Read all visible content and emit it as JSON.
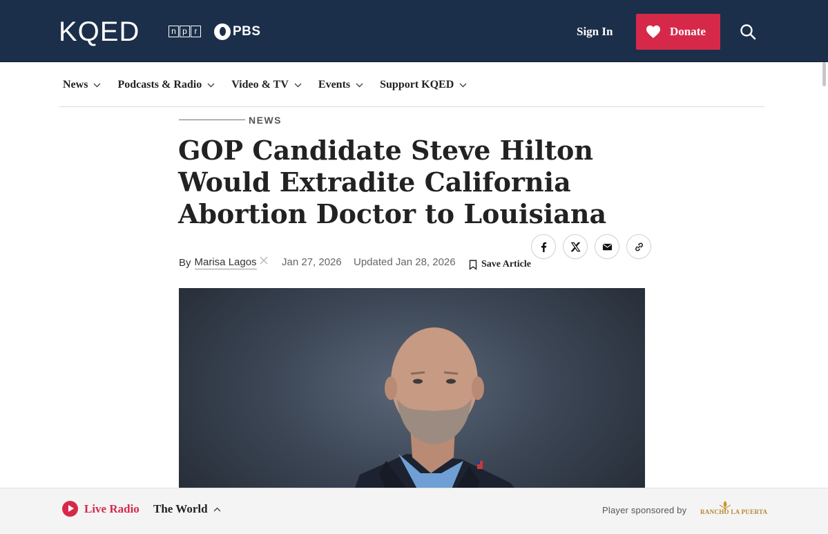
{
  "header": {
    "logo": "KQED",
    "partners": {
      "npr_letters": [
        "n",
        "p",
        "r"
      ],
      "pbs": "PBS"
    },
    "sign_in": "Sign In",
    "donate": "Donate",
    "colors": {
      "header_bg": "#1b2f4a",
      "donate_bg": "#d6294a"
    }
  },
  "nav": {
    "items": [
      {
        "label": "News"
      },
      {
        "label": "Podcasts & Radio"
      },
      {
        "label": "Video & TV"
      },
      {
        "label": "Events"
      },
      {
        "label": "Support KQED"
      }
    ]
  },
  "article": {
    "kicker": "NEWS",
    "headline": "GOP Candidate Steve Hilton Would Extradite California Abortion Doctor to Louisiana",
    "byline_prefix": "By",
    "author": "Marisa Lagos",
    "published": "Jan 27, 2026",
    "updated": "Updated Jan 28, 2026",
    "save_label": "Save Article",
    "share_icons": [
      "facebook-icon",
      "x-icon",
      "email-icon",
      "link-icon"
    ]
  },
  "player": {
    "live_label": "Live Radio",
    "station": "The World",
    "sponsored_text": "Player sponsored by",
    "sponsor_logo": "RANCHO LA PUERTA",
    "accent": "#d6294a"
  }
}
